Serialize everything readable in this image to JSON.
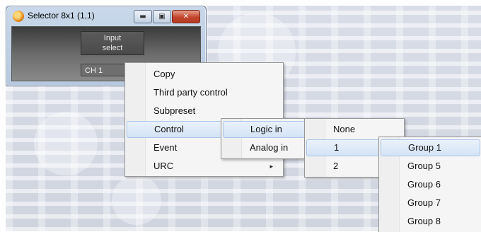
{
  "window": {
    "title": "Selector 8x1 (1,1)",
    "buttons": {
      "minimize": "▬",
      "maximize": "▣",
      "close": "✕"
    },
    "input_select_label": "Input\nselect",
    "channel_value": "CH 1"
  },
  "context_menu": {
    "items": [
      {
        "label": "Copy"
      },
      {
        "label": "Third party control"
      },
      {
        "label": "Subpreset"
      },
      {
        "label": "Control",
        "highlighted": true
      },
      {
        "label": "Event"
      },
      {
        "label": "URC",
        "submenu_arrow": "▸"
      }
    ]
  },
  "control_submenu": {
    "items": [
      {
        "label": "Logic in",
        "highlighted": true
      },
      {
        "label": "Analog in"
      }
    ]
  },
  "logic_in_submenu": {
    "items": [
      {
        "label": "None"
      },
      {
        "label": "1",
        "highlighted": true
      },
      {
        "label": "2"
      }
    ]
  },
  "group_submenu": {
    "items": [
      {
        "label": "Group 1",
        "highlighted": true
      },
      {
        "label": "Group 5"
      },
      {
        "label": "Group 6"
      },
      {
        "label": "Group 7"
      },
      {
        "label": "Group 8"
      }
    ]
  },
  "colors": {
    "highlight": "#d3e3f5",
    "highlight_border": "#a9c6ea",
    "window_frame": "#b7c9df",
    "close_button": "#c4452c"
  }
}
